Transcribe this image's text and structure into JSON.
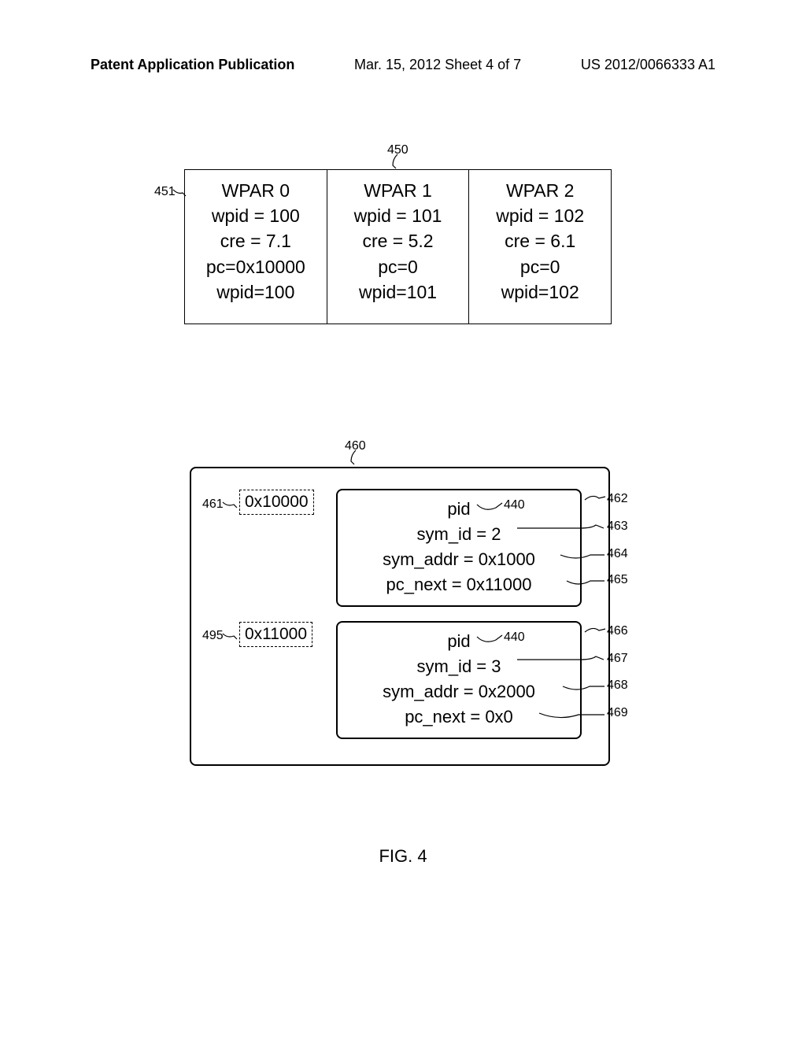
{
  "header": {
    "left": "Patent Application Publication",
    "mid": "Mar. 15, 2012  Sheet 4 of 7",
    "right": "US 2012/0066333 A1"
  },
  "refs": {
    "r450": "450",
    "r451": "451",
    "r460": "460",
    "r461": "461",
    "r495": "495",
    "r462": "462",
    "r463": "463",
    "r464": "464",
    "r465": "465",
    "r466": "466",
    "r467": "467",
    "r468": "468",
    "r469": "469",
    "r440": "440"
  },
  "table450": {
    "cols": [
      {
        "title": "WPAR 0",
        "l1": "wpid = 100",
        "l2": "cre = 7.1",
        "l3": "pc=0x10000",
        "l4": "wpid=100"
      },
      {
        "title": "WPAR 1",
        "l1": "wpid = 101",
        "l2": "cre = 5.2",
        "l3": "pc=0",
        "l4": "wpid=101"
      },
      {
        "title": "WPAR 2",
        "l1": "wpid = 102",
        "l2": "cre = 6.1",
        "l3": "pc=0",
        "l4": "wpid=102"
      }
    ]
  },
  "dashed": {
    "d461": "0x10000",
    "d495": "0x11000"
  },
  "box462": {
    "l1": "pid",
    "l2": "sym_id = 2",
    "l3": "sym_addr = 0x1000",
    "l4": "pc_next = 0x11000"
  },
  "box466": {
    "l1": "pid",
    "l2": "sym_id = 3",
    "l3": "sym_addr = 0x2000",
    "l4": "pc_next = 0x0"
  },
  "figlabel": "FIG. 4"
}
